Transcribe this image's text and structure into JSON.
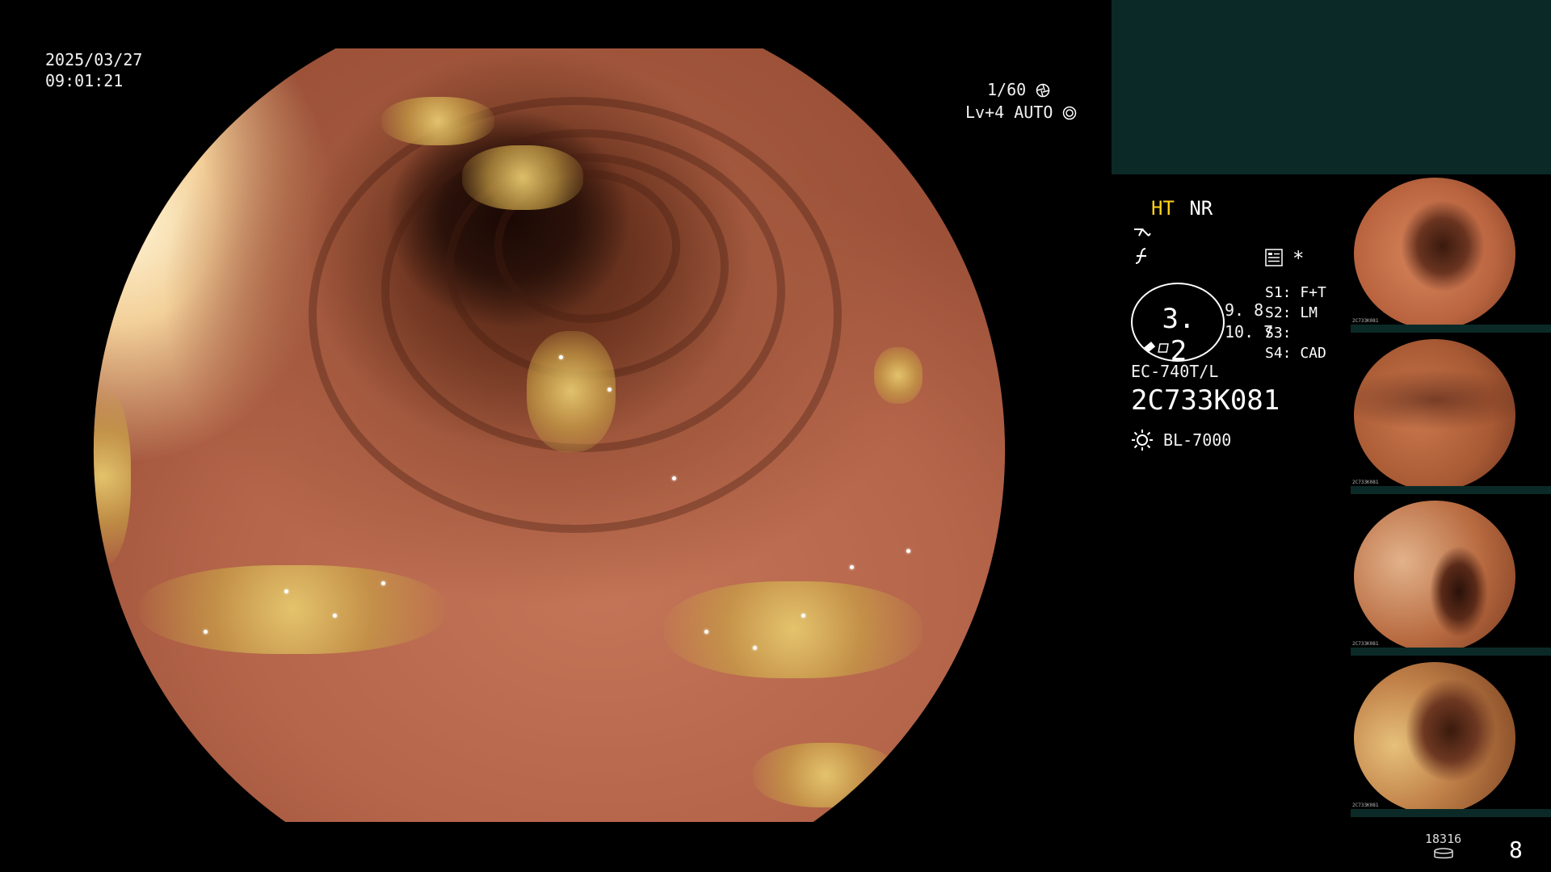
{
  "date": "2025/03/27",
  "time": "09:01:21",
  "shutter": "1/60",
  "level_mode": "Lv+4 AUTO",
  "enhancement": {
    "ht": "HT",
    "nr": "NR"
  },
  "scope_value": "3. 2",
  "side_values": [
    "9. 8",
    "10. 7"
  ],
  "switches": [
    "S1: F+T",
    "S2: LM",
    "S3:",
    "S4: CAD"
  ],
  "scope_model": "EC-740T/L",
  "serial": "2C733K081",
  "light_source": "BL-7000",
  "storage_count": "18316",
  "image_count": "8",
  "thumbnail_serial": "2C733K081",
  "colors": {
    "ht": "#ffd21a",
    "panel": "#0b2a27"
  },
  "icons": {
    "shutter": "aperture-icon",
    "auto": "auto-iris-icon",
    "menu": "menu-list-icon",
    "star": "asterisk-icon",
    "sun": "light-source-icon",
    "storage": "storage-disk-icon"
  }
}
